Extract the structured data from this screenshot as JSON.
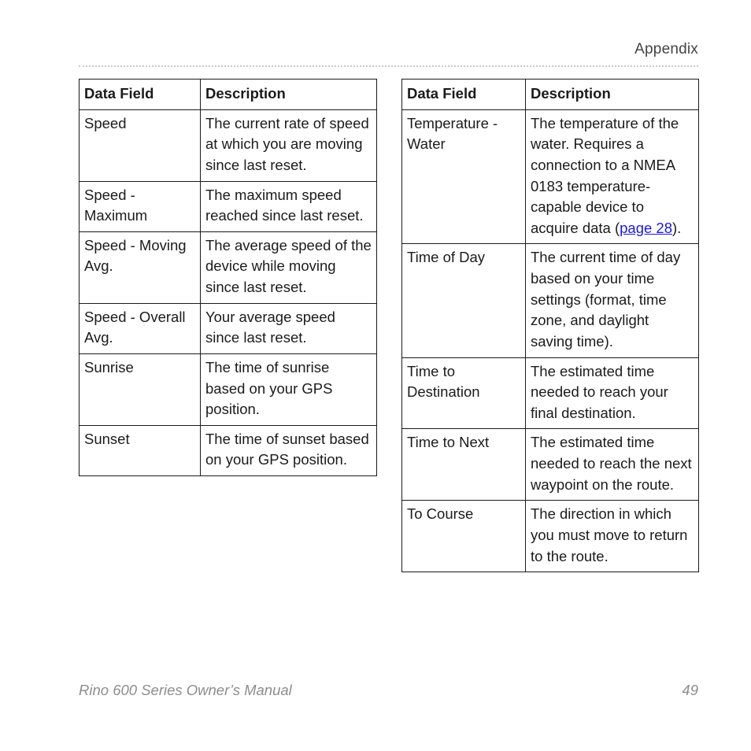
{
  "header": {
    "section_title": "Appendix"
  },
  "tables": [
    {
      "id": "left",
      "columns": [
        "Data Field",
        "Description"
      ],
      "rows": [
        {
          "field": "Speed",
          "description": "The current rate of speed at which you are moving since last reset."
        },
        {
          "field": "Speed - Maximum",
          "description": "The maximum speed reached since last reset."
        },
        {
          "field": "Speed - Moving Avg.",
          "description": "The average speed of the device while moving since last reset."
        },
        {
          "field": "Speed - Overall Avg.",
          "description": "Your average speed since last reset."
        },
        {
          "field": "Sunrise",
          "description": "The time of sunrise based on your GPS position."
        },
        {
          "field": "Sunset",
          "description": "The time of sunset based on your GPS position."
        }
      ]
    },
    {
      "id": "right",
      "columns": [
        "Data Field",
        "Description"
      ],
      "rows": [
        {
          "field": "Temperature - Water",
          "description_before": "The temperature of the water. Requires a connection to a NMEA 0183 temperature-capable device to acquire data (",
          "description_link": "page 28",
          "description_after": ")."
        },
        {
          "field": "Time of Day",
          "description": "The current time of day based on your time settings (format, time zone, and daylight saving time)."
        },
        {
          "field": "Time to Destination",
          "description": "The estimated time needed to reach your final destination."
        },
        {
          "field": "Time to Next",
          "description": "The estimated time needed to reach the next waypoint on the route."
        },
        {
          "field": "To Course",
          "description": "The direction in which you must move to return to the route."
        }
      ]
    }
  ],
  "footer": {
    "manual_title": "Rino 600 Series Owner’s Manual",
    "page_number": "49"
  },
  "colors": {
    "link": "#1a1ae0",
    "text": "#1b1b1b",
    "footer_text": "#8d8d8d",
    "header_text": "#444444",
    "rule": "#c9c9c9",
    "border": "#1a1a1a"
  }
}
